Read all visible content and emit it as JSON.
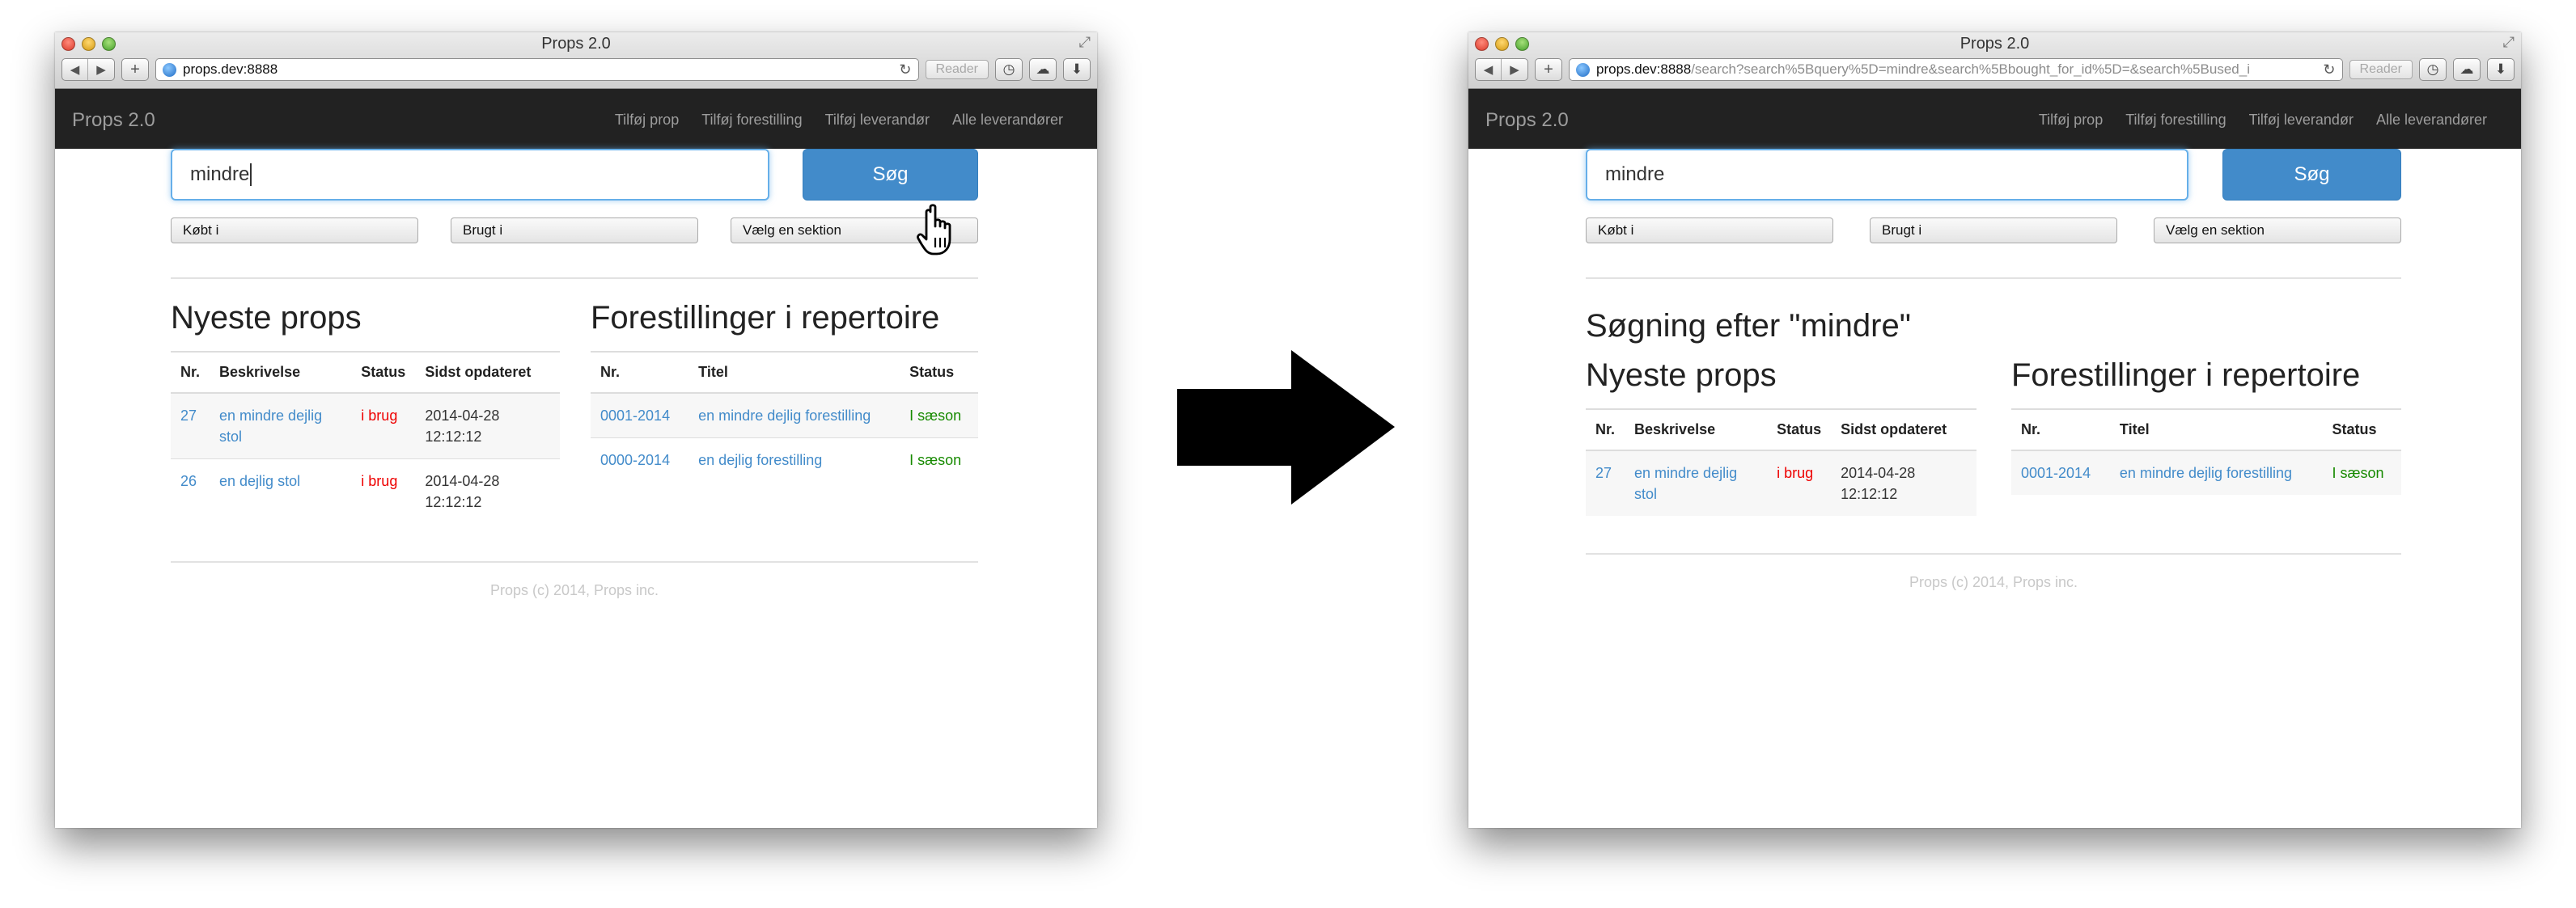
{
  "browser": {
    "title": "Props 2.0",
    "reader_label": "Reader",
    "url_before": {
      "host": "props.dev:8888",
      "rest": ""
    },
    "url_after": {
      "host": "props.dev:8888",
      "rest": "/search?search%5Bquery%5D=mindre&search%5Bbought_for_id%5D=&search%5Bused_i"
    }
  },
  "navbar": {
    "brand": "Props 2.0",
    "links": [
      "Tilføj prop",
      "Tilføj forestilling",
      "Tilføj leverandør",
      "Alle leverandører"
    ]
  },
  "search": {
    "query": "mindre",
    "button_label": "Søg",
    "selects": [
      "Købt i",
      "Brugt i",
      "Vælg en sektion"
    ]
  },
  "before": {
    "props_heading": "Nyeste props",
    "props_columns": [
      "Nr.",
      "Beskrivelse",
      "Status",
      "Sidst opdateret"
    ],
    "props_rows": [
      {
        "nr": "27",
        "description": "en mindre dejlig stol",
        "status": "i brug",
        "updated": "2014-04-28 12:12:12"
      },
      {
        "nr": "26",
        "description": "en dejlig stol",
        "status": "i brug",
        "updated": "2014-04-28 12:12:12"
      }
    ],
    "shows_heading": "Forestillinger i repertoire",
    "shows_columns": [
      "Nr.",
      "Titel",
      "Status"
    ],
    "shows_rows": [
      {
        "nr": "0001-2014",
        "title": "en mindre dejlig forestilling",
        "status": "I sæson"
      },
      {
        "nr": "0000-2014",
        "title": "en dejlig forestilling",
        "status": "I sæson"
      }
    ]
  },
  "after": {
    "search_heading": "Søgning efter \"mindre\"",
    "props_heading": "Nyeste props",
    "props_columns": [
      "Nr.",
      "Beskrivelse",
      "Status",
      "Sidst opdateret"
    ],
    "props_rows": [
      {
        "nr": "27",
        "description": "en mindre dejlig stol",
        "status": "i brug",
        "updated": "2014-04-28 12:12:12"
      }
    ],
    "shows_heading": "Forestillinger i repertoire",
    "shows_columns": [
      "Nr.",
      "Titel",
      "Status"
    ],
    "shows_rows": [
      {
        "nr": "0001-2014",
        "title": "en mindre dejlig forestilling",
        "status": "I sæson"
      }
    ]
  },
  "footer": "Props (c) 2014, Props inc.",
  "colors": {
    "navbar_bg": "#222222",
    "primary": "#428bca",
    "status_in_use": "#ee0000",
    "status_in_season": "#178a00",
    "transition_arrow": "#000000"
  },
  "icons": [
    "back-arrow-icon",
    "forward-arrow-icon",
    "add-tab-icon",
    "globe-icon",
    "reload-icon",
    "history-icon",
    "icloud-icon",
    "download-icon",
    "resize-icon",
    "hand-cursor-icon",
    "transition-arrow-icon"
  ]
}
